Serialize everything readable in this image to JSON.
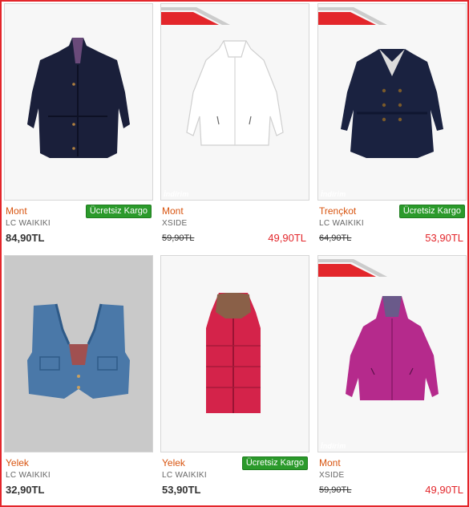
{
  "colors": {
    "frame": "#e3262b",
    "category": "#d8540f",
    "sale_price": "#e3262b",
    "cargo_badge": "#2b9a2b"
  },
  "products": [
    {
      "category": "Mont",
      "brand": "LC WAIKIKI",
      "price": "84,90TL",
      "badge": "Ücretsiz Kargo",
      "image": "navy-jacket"
    },
    {
      "category": "Mont",
      "brand": "XSIDE",
      "old_price": "59,90TL",
      "new_price": "49,90TL",
      "sale_badge": "İndirim",
      "image": "white-jacket"
    },
    {
      "category": "Trençkot",
      "brand": "LC WAIKIKI",
      "old_price": "64,90TL",
      "new_price": "53,90TL",
      "badge": "Ücretsiz Kargo",
      "sale_badge": "İndirim",
      "image": "navy-trenchcoat"
    },
    {
      "category": "Yelek",
      "brand": "LC WAIKIKI",
      "price": "32,90TL",
      "image": "denim-vest"
    },
    {
      "category": "Yelek",
      "brand": "LC WAIKIKI",
      "price": "53,90TL",
      "badge": "Ücretsiz Kargo",
      "image": "red-puffer-vest"
    },
    {
      "category": "Mont",
      "brand": "XSIDE",
      "old_price": "59,90TL",
      "new_price": "49,90TL",
      "sale_badge": "İndirim",
      "image": "magenta-jacket"
    }
  ]
}
